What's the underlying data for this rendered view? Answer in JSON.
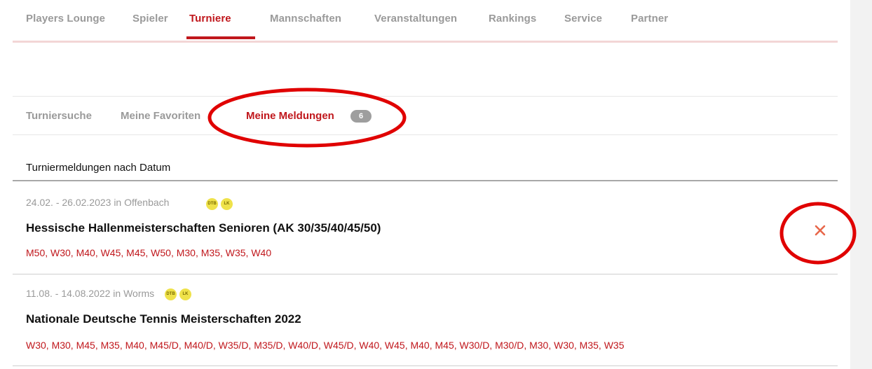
{
  "topnav": {
    "items": [
      {
        "label": "Players Lounge"
      },
      {
        "label": "Spieler"
      },
      {
        "label": "Turniere"
      },
      {
        "label": "Mannschaften"
      },
      {
        "label": "Veranstaltungen"
      },
      {
        "label": "Rankings"
      },
      {
        "label": "Service"
      },
      {
        "label": "Partner"
      }
    ],
    "active": "Turniere"
  },
  "subtabs": {
    "items": [
      {
        "label": "Turniersuche"
      },
      {
        "label": "Meine Favoriten"
      },
      {
        "label": "Meine Meldungen"
      }
    ],
    "active": "Meine Meldungen",
    "badge": "6"
  },
  "section": {
    "title": "Turniermeldungen nach Datum"
  },
  "entries": [
    {
      "date": "24.02. - 26.02.2023 in Offenbach",
      "tags": [
        "DTB",
        "LK"
      ],
      "title": "Hessische Hallenmeisterschaften Senioren (AK 30/35/40/45/50)",
      "categories": "M50, W30, M40, W45, M45, W50, M30, M35, W35, W40",
      "delete_icon": "close-x-icon"
    },
    {
      "date": "11.08. - 14.08.2022 in Worms",
      "tags": [
        "DTB",
        "LK"
      ],
      "title": "Nationale Deutsche Tennis Meisterschaften 2022",
      "categories": "W30, M30, M45, M35, M40, M45/D, M40/D, W35/D, M35/D, W40/D, W45/D, W40, W45, M40, M45, W30/D, M30/D, M30, W30, M35, W35"
    }
  ],
  "colors": {
    "accent": "#c0171c",
    "muted": "#9a9a9a",
    "badge": "#9e9e9e",
    "tag": "#efe24a",
    "annotation": "#e00000"
  }
}
